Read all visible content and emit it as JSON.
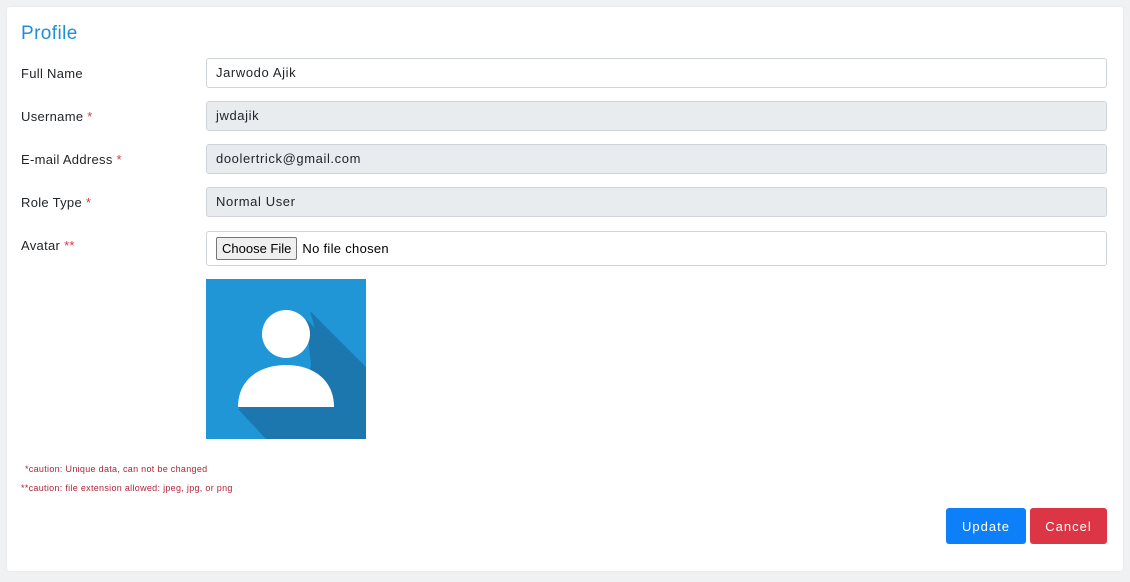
{
  "page": {
    "title": "Profile"
  },
  "form": {
    "full_name": {
      "label": "Full Name",
      "value": "Jarwodo Ajik"
    },
    "username": {
      "label": "Username",
      "required_mark": "*",
      "value": "jwdajik"
    },
    "email": {
      "label": "E-mail Address",
      "required_mark": "*",
      "value": "doolertrick@gmail.com"
    },
    "role": {
      "label": "Role Type",
      "required_mark": "*",
      "value": "Normal User"
    },
    "avatar": {
      "label": "Avatar",
      "required_mark": "**",
      "button_label": "Choose File",
      "status": "No file chosen",
      "image_icon": "default-user-avatar-icon"
    }
  },
  "notes": {
    "caution_1": "*caution: Unique data, can not be changed",
    "caution_2": "**caution: file extension allowed: jpeg, jpg, or png"
  },
  "actions": {
    "update_label": "Update",
    "cancel_label": "Cancel"
  },
  "colors": {
    "title": "#1e8fd6",
    "required": "#dc3545",
    "readonly_bg": "#e9ecef",
    "update_button": "#0d7ff8",
    "cancel_button": "#dc3545",
    "avatar_bg": "#2196d6"
  }
}
